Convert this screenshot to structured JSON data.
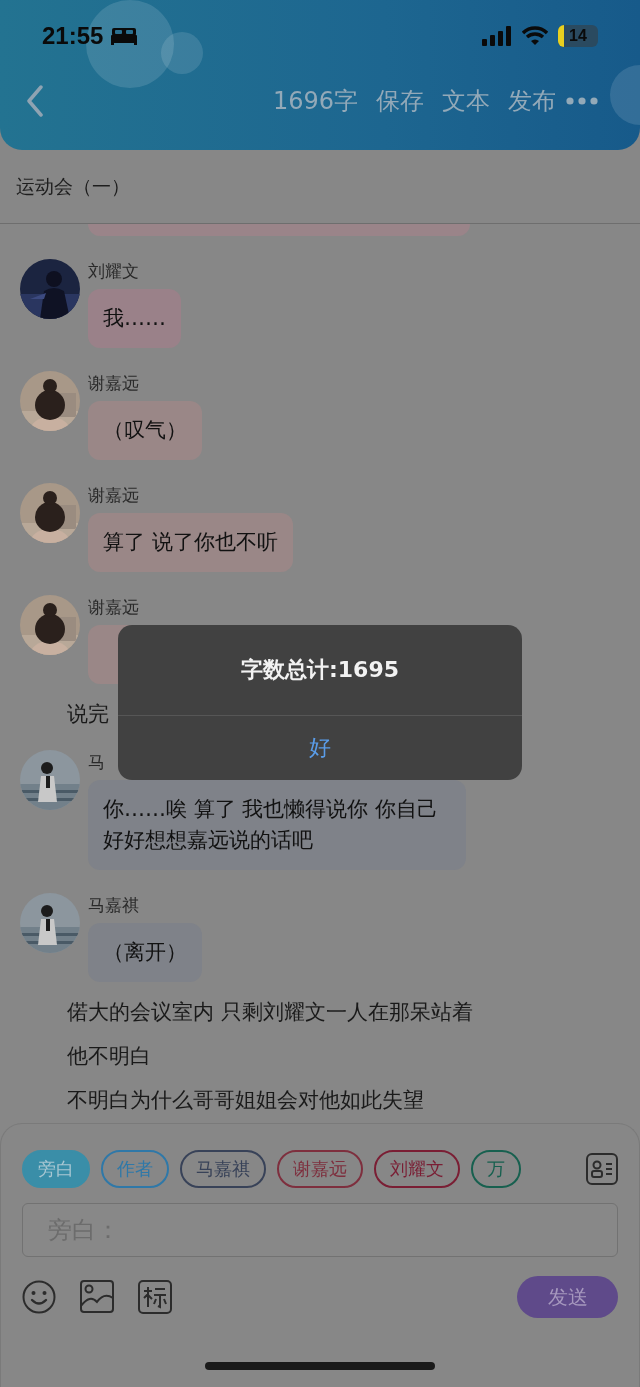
{
  "status_bar": {
    "time": "21:55",
    "battery": "14"
  },
  "nav": {
    "actions": [
      "1696字",
      "保存",
      "文本",
      "发布"
    ]
  },
  "chapter_title": "运动会（一）",
  "messages": [
    {
      "kind": "clipped",
      "color": "#9a8489"
    },
    {
      "kind": "dialogue",
      "speaker": "刘耀文",
      "text": "我……",
      "color": "#9a8189"
    },
    {
      "kind": "dialogue",
      "speaker": "谢嘉远",
      "text": "（叹气）",
      "color": "#9a8787"
    },
    {
      "kind": "dialogue",
      "speaker": "谢嘉远",
      "text": "算了 说了你也不听",
      "color": "#9a8787"
    },
    {
      "kind": "dialogue",
      "speaker": "谢嘉远",
      "color": "#9a8787"
    },
    {
      "kind": "narration",
      "text": "说完"
    },
    {
      "kind": "dialogue",
      "speaker": "马",
      "text": "你……唉 算了 我也懒得说你 你自己好好想想嘉远说的话吧",
      "color": "#7f8289"
    },
    {
      "kind": "dialogue",
      "speaker": "马嘉祺",
      "text": "（离开）",
      "color": "#7f8289"
    },
    {
      "kind": "narration",
      "text": "偌大的会议室内 只剩刘耀文一人在那呆站着"
    },
    {
      "kind": "narration",
      "text": "他不明白"
    },
    {
      "kind": "narration",
      "text": "不明白为什么哥哥姐姐会对他如此失望"
    }
  ],
  "dialog": {
    "message": "字数总计:1695",
    "button": "好"
  },
  "composer": {
    "roles": [
      {
        "label": "旁白",
        "color": "#3a8ea8",
        "selected": true
      },
      {
        "label": "作者",
        "color": "#2f78a8",
        "selected": false
      },
      {
        "label": "马嘉祺",
        "color": "#384258",
        "selected": false
      },
      {
        "label": "谢嘉远",
        "color": "#7e2f3e",
        "selected": false
      },
      {
        "label": "刘耀文",
        "color": "#7a1e34",
        "selected": false
      },
      {
        "label": "万",
        "color": "#17604f",
        "selected": false
      }
    ],
    "placeholder": "旁白：",
    "send": "发送"
  }
}
